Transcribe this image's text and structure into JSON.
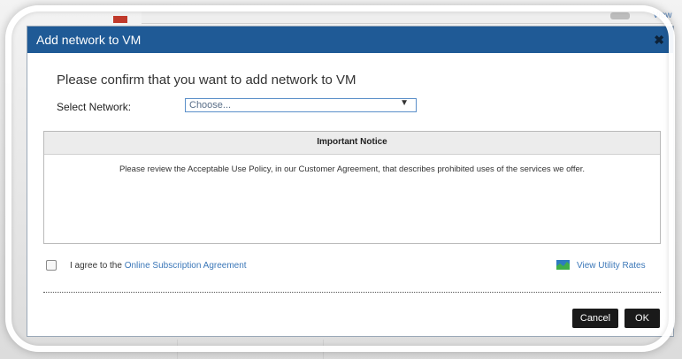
{
  "background": {
    "view_label": "View"
  },
  "dialog": {
    "title": "Add network to VM",
    "close_symbol": "✖",
    "headline": "Please confirm that you want to add network to VM",
    "network_label": "Select Network:",
    "network_select": {
      "value": "Choose...",
      "arrow": "▼"
    },
    "notice": {
      "title": "Important Notice",
      "body": "Please review the Acceptable Use Policy, in our Customer Agreement, that describes prohibited uses of the services we offer."
    },
    "agreement": {
      "prefix": "I agree to the ",
      "link": "Online Subscription Agreement",
      "checked": false
    },
    "utility_rates_link": "View Utility Rates",
    "buttons": {
      "cancel": "Cancel",
      "ok": "OK"
    }
  },
  "colors": {
    "titlebar": "#1f5a96",
    "link": "#3b77b8",
    "button": "#1a1a1a"
  },
  "icons": [
    "close-icon",
    "chevron-down-icon",
    "chart-area-icon",
    "checkbox-icon"
  ]
}
